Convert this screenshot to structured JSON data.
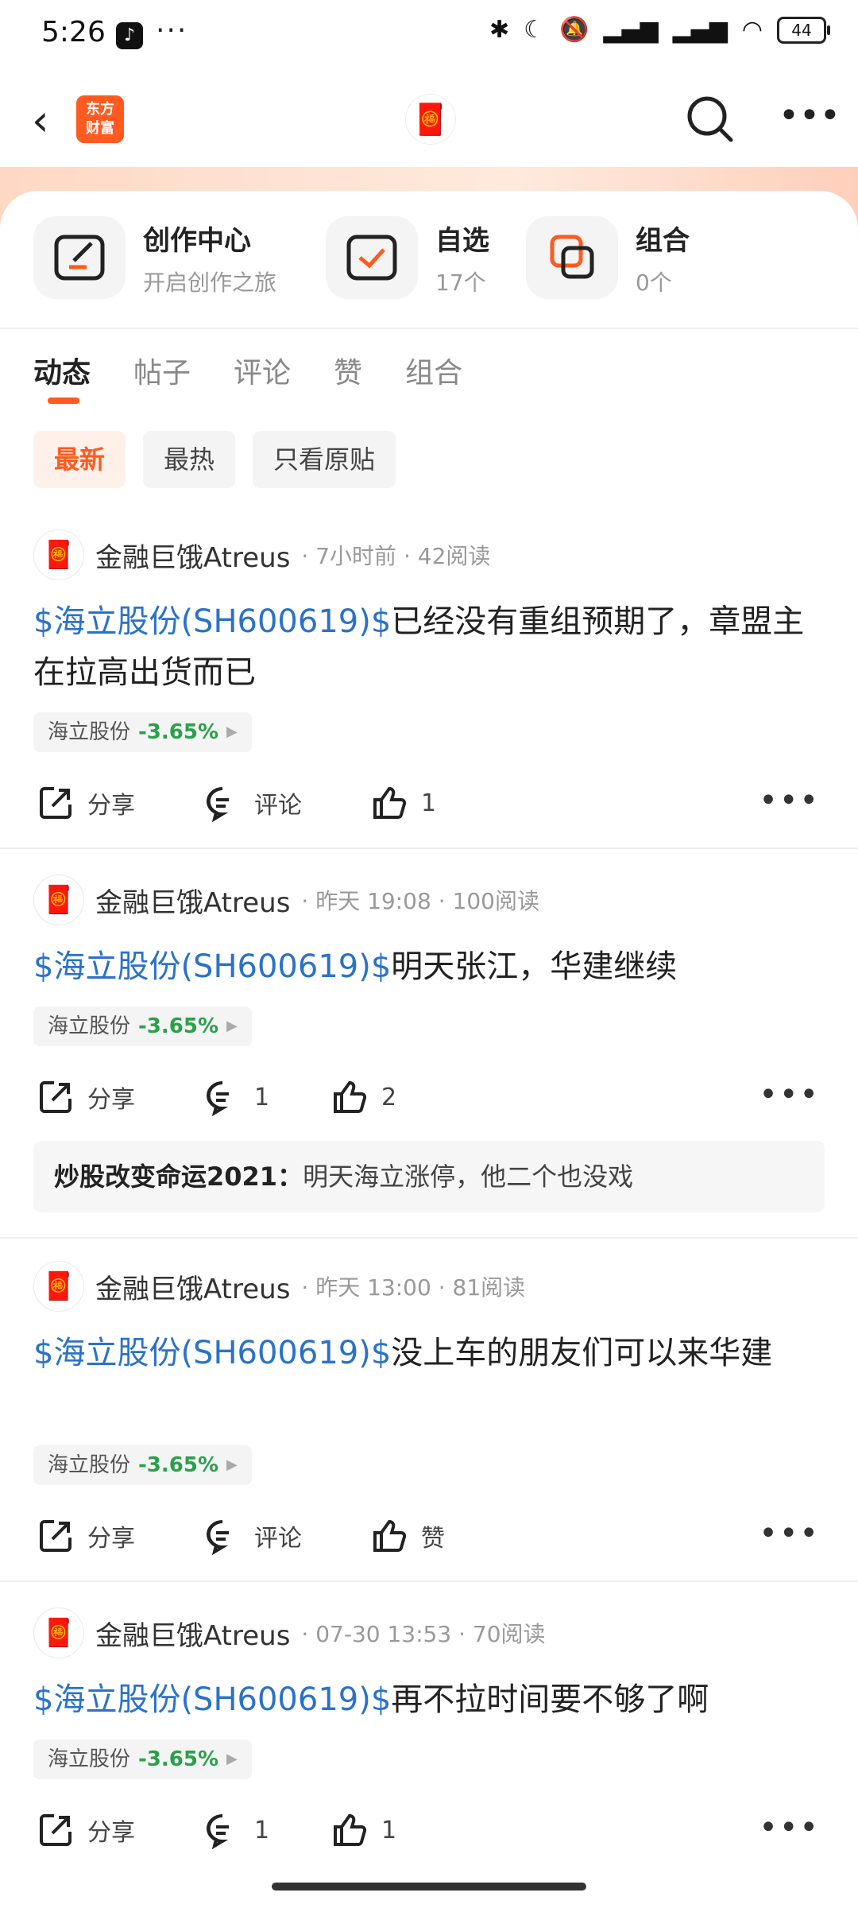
{
  "status_bar": {
    "time": "5:26",
    "app_icon_glyph": "♪",
    "more": "···",
    "battery": "44"
  },
  "nav": {
    "logo_line1": "东方",
    "logo_line2": "财富",
    "avatar_glyph": "🧧"
  },
  "quick_links": [
    {
      "title": "创作中心",
      "sub": "开启创作之旅"
    },
    {
      "title": "自选",
      "sub": "17个"
    },
    {
      "title": "组合",
      "sub": "0个"
    }
  ],
  "tabs": [
    "动态",
    "帖子",
    "评论",
    "赞",
    "组合"
  ],
  "filters": [
    "最新",
    "最热",
    "只看原贴"
  ],
  "posts": [
    {
      "author": "金融巨饿Atreus",
      "time": "7小时前",
      "reads": "42阅读",
      "stock_text": "$海立股份(SH600619)$",
      "text": "已经没有重组预期了，章盟主在拉高出货而已",
      "tag_name": "海立股份",
      "tag_pct": "-3.65%",
      "share": "分享",
      "comment": "评论",
      "like": "1"
    },
    {
      "author": "金融巨饿Atreus",
      "time": "昨天 19:08",
      "reads": "100阅读",
      "stock_text": "$海立股份(SH600619)$",
      "text": "明天张江，华建继续",
      "tag_name": "海立股份",
      "tag_pct": "-3.65%",
      "share": "分享",
      "comment": "1",
      "like": "2",
      "reply_name": "炒股改变命运2021：",
      "reply_text": "明天海立涨停，他二个也没戏"
    },
    {
      "author": "金融巨饿Atreus",
      "time": "昨天 13:00",
      "reads": "81阅读",
      "stock_text": "$海立股份(SH600619)$",
      "text": "没上车的朋友们可以来华建",
      "tag_name": "海立股份",
      "tag_pct": "-3.65%",
      "share": "分享",
      "comment": "评论",
      "like": "赞"
    },
    {
      "author": "金融巨饿Atreus",
      "time": "07-30 13:53",
      "reads": "70阅读",
      "stock_text": "$海立股份(SH600619)$",
      "text": "再不拉时间要不够了啊",
      "tag_name": "海立股份",
      "tag_pct": "-3.65%",
      "share": "分享",
      "comment": "1",
      "like": "1"
    }
  ],
  "colors": {
    "accent": "#ff5a1f",
    "stock_link": "#2a72c8",
    "down": "#2aa04a"
  }
}
